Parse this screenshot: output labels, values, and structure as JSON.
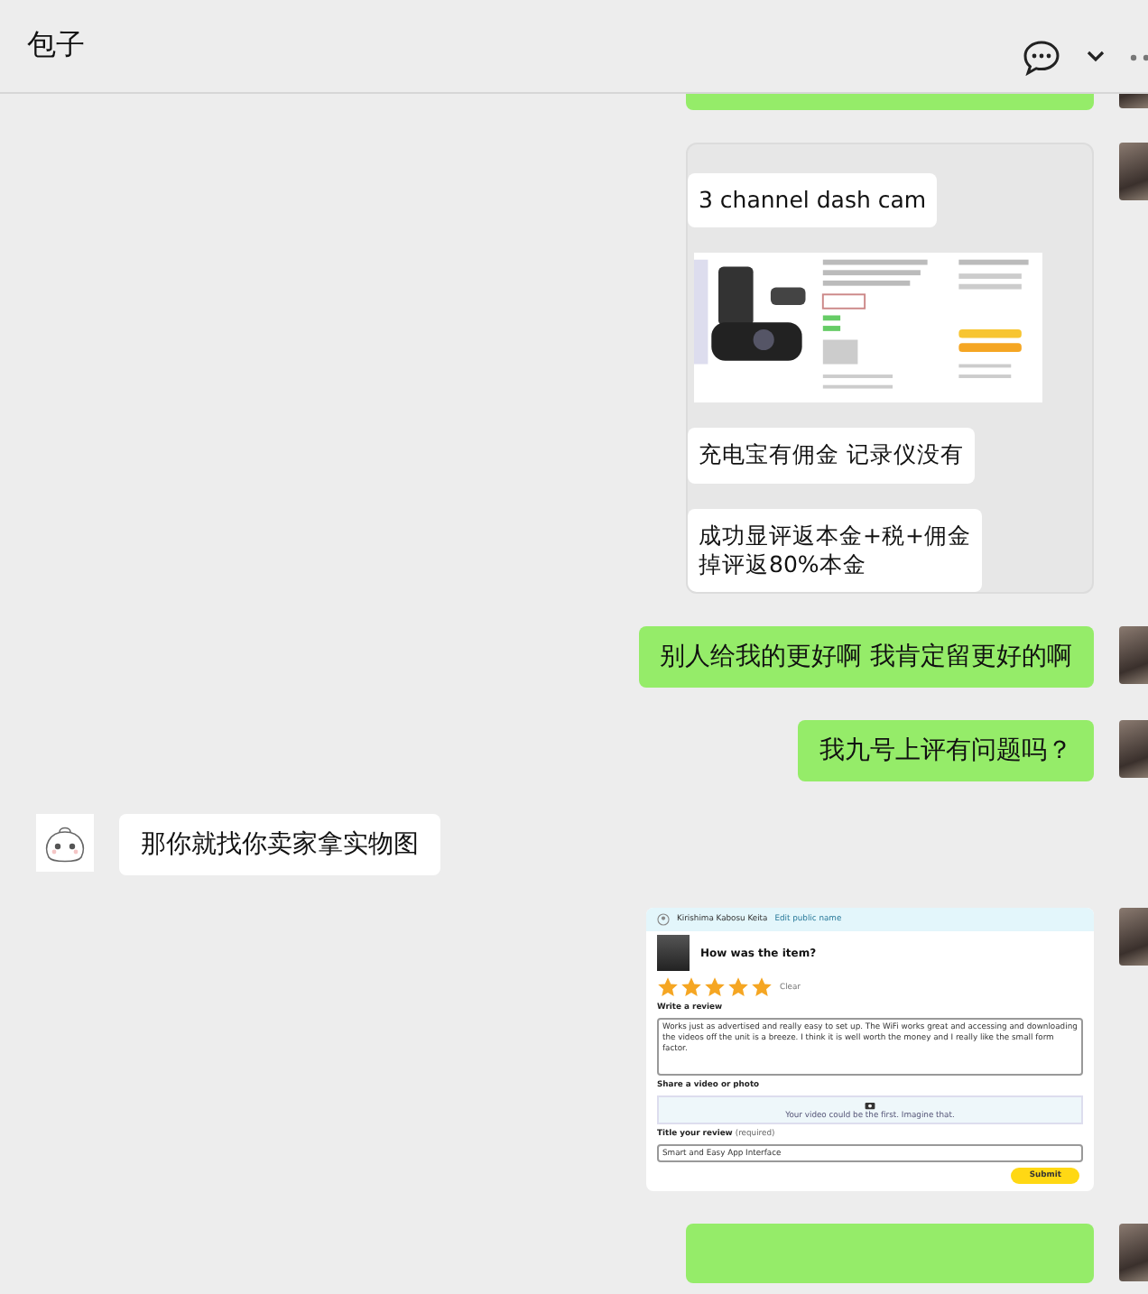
{
  "header": {
    "title": "包子"
  },
  "messages": [
    {
      "kind": "clipped",
      "outgoing": true
    },
    {
      "kind": "forward_card",
      "outgoing": true,
      "items": [
        {
          "kind": "text",
          "text": "3 channel dash cam"
        },
        {
          "kind": "image"
        },
        {
          "kind": "text",
          "text": "充电宝有佣金 记录仪没有"
        },
        {
          "kind": "lines",
          "lines": [
            "成功显评返本金+税+佣金",
            "掉评返80%本金"
          ]
        }
      ]
    },
    {
      "kind": "text",
      "outgoing": true,
      "text": "别人给我的更好啊 我肯定留更好的啊"
    },
    {
      "kind": "text",
      "outgoing": true,
      "text": "我九号上评有问题吗？"
    },
    {
      "kind": "text",
      "outgoing": false,
      "text": "那你就找你卖家拿实物图"
    },
    {
      "kind": "review_screenshot",
      "outgoing": true,
      "review": {
        "user": "Kirishima Kabosu Keita",
        "edit_link": "Edit public name",
        "question": "How was the item?",
        "stars": 5,
        "clear": "Clear",
        "write_label": "Write a review",
        "review_text": "Works just as advertised and really easy to set up. The WiFi works great and accessing and downloading the videos off the unit is a breeze. I think it is well worth the money and I really like the small form factor.",
        "share_label": "Share a video or photo",
        "share_hint": "Your video could be the first. Imagine that.",
        "title_label": "Title your review",
        "title_note": "(required)",
        "title_value": "Smart and Easy App Interface",
        "submit": "Submit"
      }
    },
    {
      "kind": "clipped",
      "outgoing": true
    }
  ]
}
